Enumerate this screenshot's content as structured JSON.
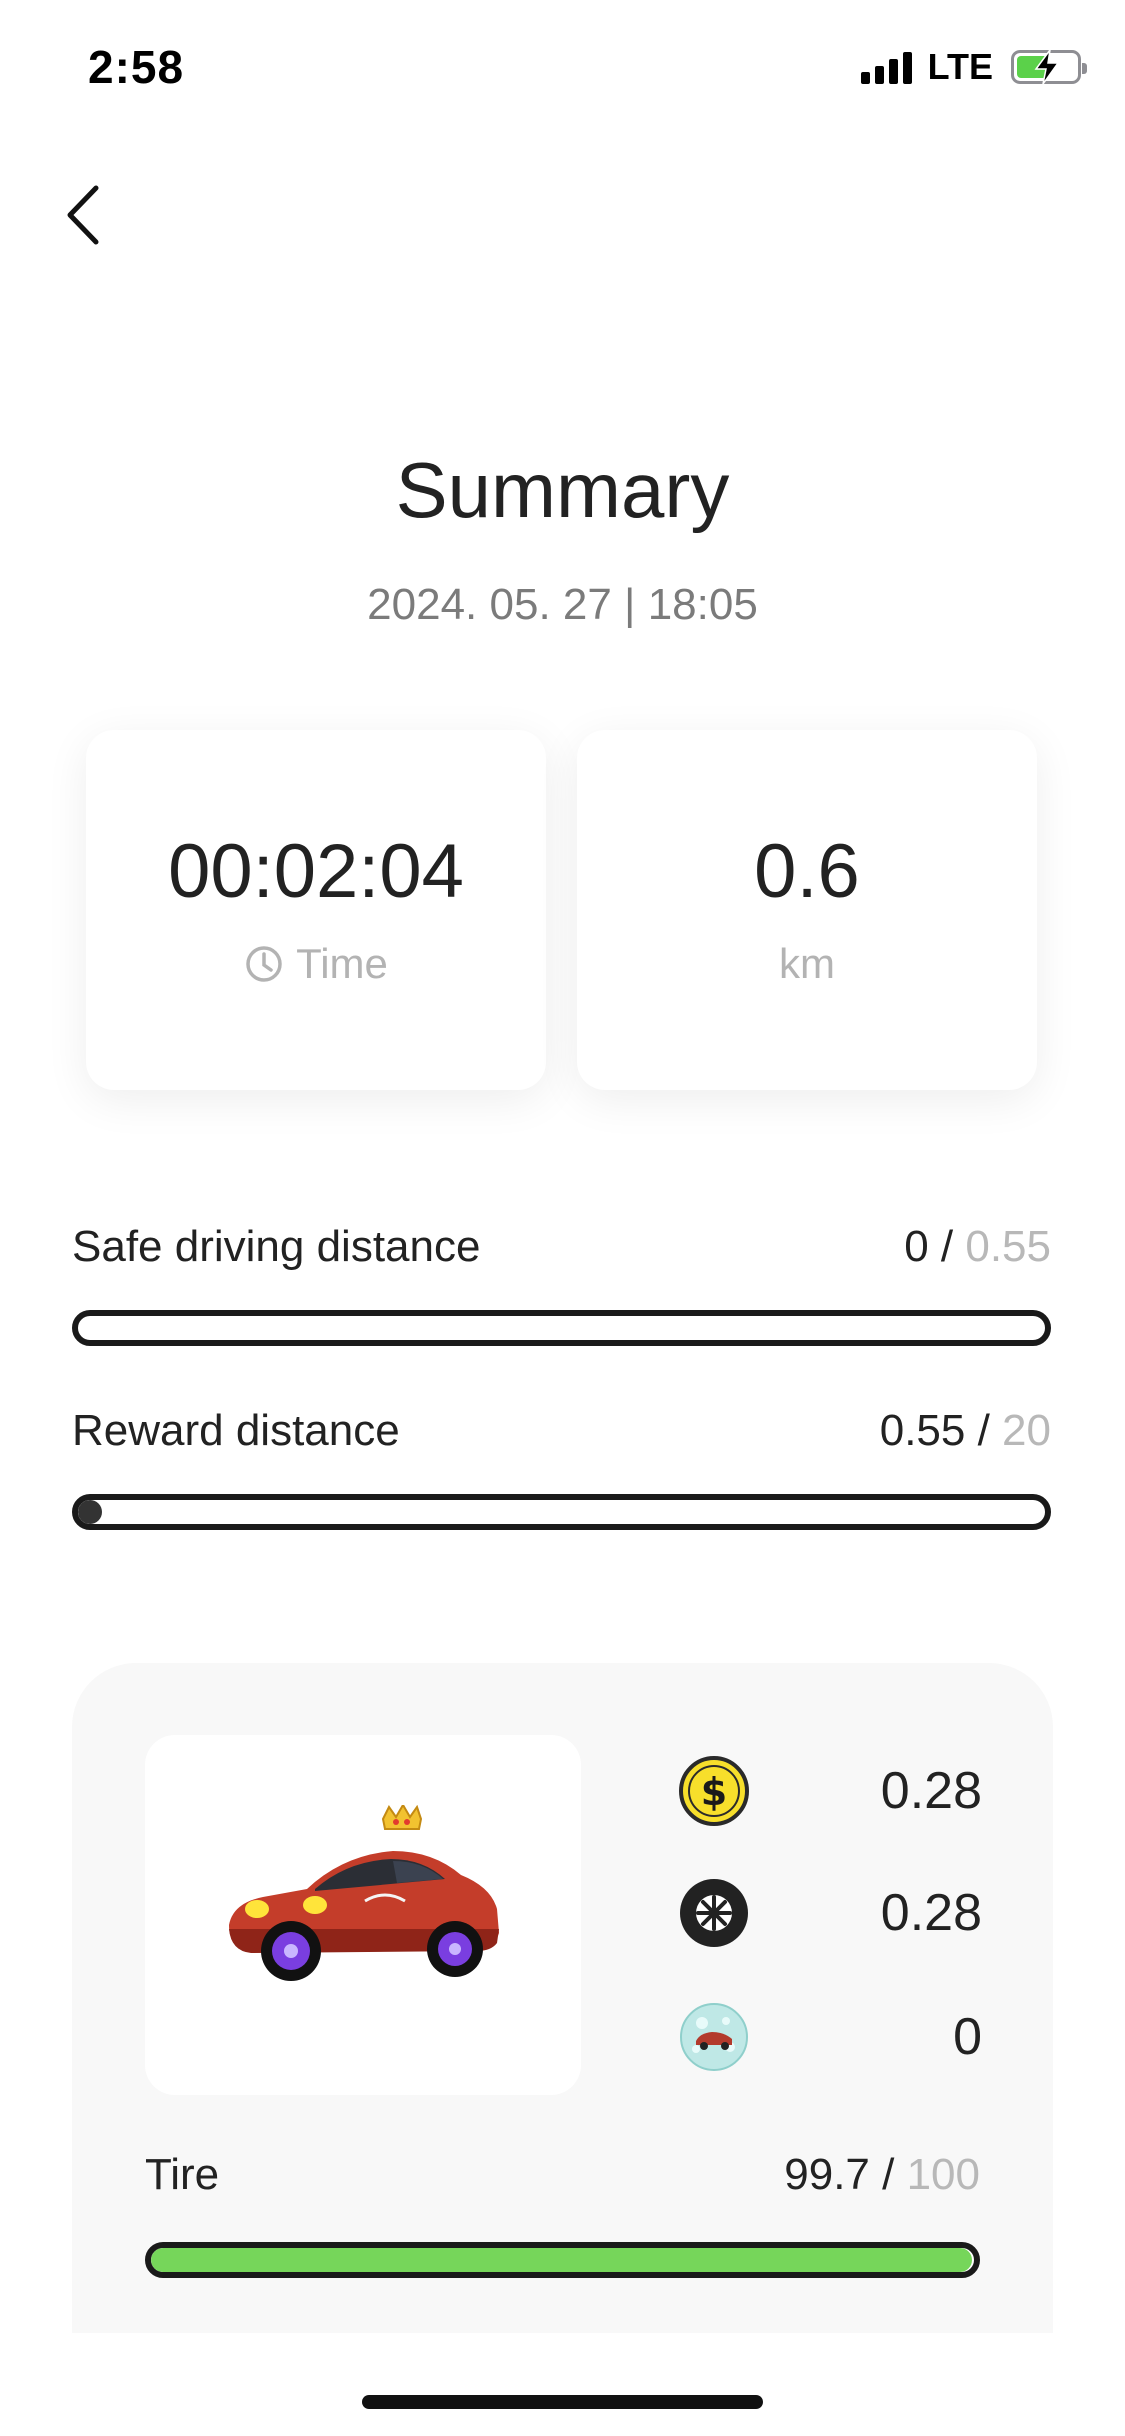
{
  "status_bar": {
    "time": "2:58",
    "network": "LTE",
    "battery_level": 0.55,
    "battery_charging": true
  },
  "nav": {
    "back_icon": "chevron-left-icon"
  },
  "header": {
    "title": "Summary",
    "date": "2024. 05. 27 | 18:05"
  },
  "stats": {
    "time": {
      "value": "00:02:04",
      "label": "Time",
      "icon": "clock-icon"
    },
    "distance": {
      "value": "0.6",
      "label": "km"
    }
  },
  "metrics": {
    "safe_driving": {
      "label": "Safe driving distance",
      "current": "0",
      "separator": " / ",
      "max": "0.55",
      "progress": 0.0
    },
    "reward": {
      "label": "Reward distance",
      "current": "0.55",
      "separator": " / ",
      "max": "20",
      "progress": 0.0275
    }
  },
  "rewards": {
    "car_image": "red-sports-car-with-crown",
    "items": [
      {
        "icon": "dollar-coin-icon",
        "amount": "0.28"
      },
      {
        "icon": "tire-wheel-icon",
        "amount": "0.28"
      },
      {
        "icon": "crystal-ball-car-icon",
        "amount": "0"
      }
    ]
  },
  "tire": {
    "label": "Tire",
    "current": "99.7",
    "separator": " / ",
    "max": "100",
    "progress": 0.997,
    "fill_color": "#76d65a"
  }
}
